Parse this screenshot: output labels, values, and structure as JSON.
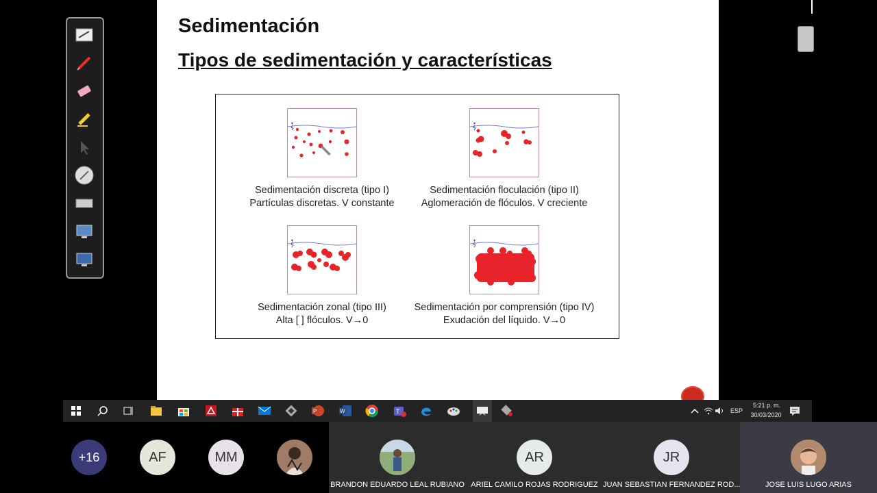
{
  "slide": {
    "title": "Sedimentación",
    "subtitle": "Tipos de sedimentación y características",
    "panels": [
      {
        "caption_line1": "Sedimentación discreta (tipo I)",
        "caption_line2": "Partículas discretas. V constante"
      },
      {
        "caption_line1": "Sedimentación floculación (tipo II)",
        "caption_line2": "Aglomeración de flóculos. V creciente"
      },
      {
        "caption_line1": "Sedimentación zonal (tipo III)",
        "caption_line2": "Alta [ ] flóculos. V→0"
      },
      {
        "caption_line1": "Sedimentación por comprensión (tipo IV)",
        "caption_line2": "Exudación del líquido. V→0"
      }
    ]
  },
  "colors": {
    "particle": "#e8232a",
    "water_line": "#7b7bd6",
    "tank_border": "#b58ab5",
    "taskbar": "#232323"
  },
  "pen_toolbar": {
    "tools": [
      "notes-icon",
      "pen-icon",
      "eraser-icon",
      "highlighter-icon",
      "pointer-icon",
      "spotlight-icon",
      "keyboard-icon",
      "screen-capture-icon",
      "desktop-icon"
    ]
  },
  "taskbar": {
    "apps": [
      "start-icon",
      "search-icon",
      "task-view-icon",
      "file-explorer-icon",
      "store-icon",
      "acrobat-icon",
      "gift-icon",
      "mail-icon",
      "app-icon",
      "powerpoint-icon",
      "word-icon",
      "chrome-icon",
      "teams-icon",
      "edge-icon",
      "paint-icon",
      "presenter-icon",
      "projector-icon"
    ],
    "language": "ESP",
    "time": "5:21 p. m.",
    "date": "30/03/2020"
  },
  "participants": [
    {
      "initials": "+16",
      "name": ""
    },
    {
      "initials": "AF",
      "name": ""
    },
    {
      "initials": "MM",
      "name": ""
    },
    {
      "initials": "",
      "name": ""
    },
    {
      "initials": "",
      "name": "BRANDON EDUARDO LEAL RUBIANO"
    },
    {
      "initials": "AR",
      "name": "ARIEL CAMILO ROJAS RODRIGUEZ"
    },
    {
      "initials": "JR",
      "name": "JUAN SEBASTIAN FERNANDEZ ROD..."
    },
    {
      "initials": "",
      "name": "JOSE LUIS LUGO ARIAS"
    }
  ]
}
